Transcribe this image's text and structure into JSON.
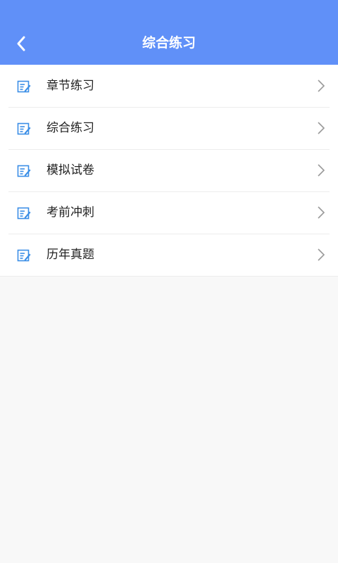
{
  "header": {
    "title": "综合练习",
    "back_icon": "chevron-left-icon"
  },
  "list": {
    "items": [
      {
        "label": "章节练习",
        "icon": "edit-note-icon"
      },
      {
        "label": "综合练习",
        "icon": "edit-note-icon"
      },
      {
        "label": "模拟试卷",
        "icon": "edit-note-icon"
      },
      {
        "label": "考前冲刺",
        "icon": "edit-note-icon"
      },
      {
        "label": "历年真题",
        "icon": "edit-note-icon"
      }
    ]
  },
  "colors": {
    "header_bg": "#6090f8",
    "icon_blue": "#3a8ee6",
    "chevron": "#9a9a9a"
  }
}
